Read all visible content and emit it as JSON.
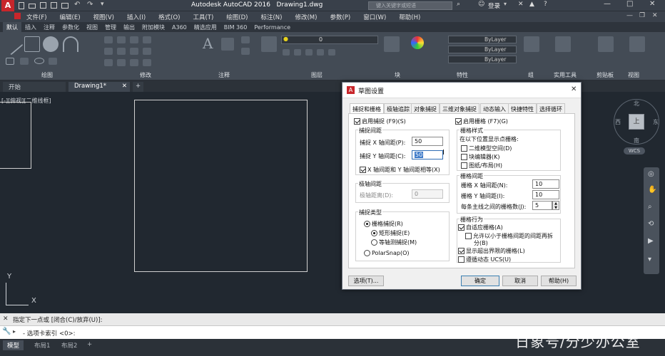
{
  "app": {
    "title": "Autodesk AutoCAD 2016",
    "filename": "Drawing1.dwg",
    "search_placeholder": "键入关键字或短语",
    "login_label": "登录"
  },
  "menu": [
    "文件(F)",
    "编辑(E)",
    "视图(V)",
    "插入(I)",
    "格式(O)",
    "工具(T)",
    "绘图(D)",
    "标注(N)",
    "修改(M)",
    "参数(P)",
    "窗口(W)",
    "帮助(H)"
  ],
  "ribbon_tabs": [
    "默认",
    "插入",
    "注释",
    "参数化",
    "视图",
    "管理",
    "输出",
    "附加模块",
    "A360",
    "精选应用",
    "BIM 360",
    "Performance"
  ],
  "ribbon_groups": [
    "绘图",
    "修改",
    "注释",
    "图层",
    "块",
    "特性",
    "组",
    "实用工具",
    "剪贴板",
    "视图"
  ],
  "ribbon_controls": {
    "layer_value": "0",
    "bylayer1": "ByLayer",
    "bylayer2": "ByLayer",
    "bylayer3": "ByLayer"
  },
  "doc_tabs": {
    "start": "开始",
    "active": "Drawing1*",
    "add": "+"
  },
  "viewport_label": "[-][俯视][二维线框]",
  "viewcube": {
    "n": "北",
    "s": "南",
    "e": "东",
    "w": "西",
    "top": "上",
    "wcs": "WCS"
  },
  "ucs": {
    "x": "X",
    "y": "Y"
  },
  "command": {
    "history": "指定下一点或 [闭合(C)/放弃(U)]:",
    "prompt": "- 选项卡索引 <0>:"
  },
  "layout_tabs": [
    "模型",
    "布局1",
    "布局2",
    "+"
  ],
  "watermark": "日象号/分少办公室",
  "dialog": {
    "title": "草图设置",
    "tabs": [
      "捕捉和栅格",
      "极轴追踪",
      "对象捕捉",
      "三维对象捕捉",
      "动态输入",
      "快捷特性",
      "选择循环"
    ],
    "snap_on": "启用捕捉 (F9)(S)",
    "snap_spacing_title": "捕捉间距",
    "snap_x_label": "捕捉 X 轴间距(P):",
    "snap_x_value": "50",
    "snap_y_label": "捕捉 Y 轴间距(C):",
    "snap_y_value": "50",
    "equal_xy": "X 轴间距和 Y 轴间距相等(X)",
    "polar_spacing_title": "极轴间距",
    "polar_distance_label": "极轴距离(D):",
    "polar_distance_value": "0",
    "snap_type_title": "捕捉类型",
    "grid_snap": "栅格捕捉(R)",
    "rect_snap": "矩形捕捉(E)",
    "iso_snap": "等轴测捕捉(M)",
    "polar_snap": "PolarSnap(O)",
    "grid_on": "启用栅格 (F7)(G)",
    "grid_style_title": "栅格样式",
    "grid_style_sub": "在以下位置显示点栅格:",
    "model_space": "二维模型空间(D)",
    "block_editor": "块编辑器(K)",
    "sheet_layout": "图纸/布局(H)",
    "grid_spacing_title": "栅格间距",
    "grid_x_label": "栅格 X 轴间距(N):",
    "grid_x_value": "10",
    "grid_y_label": "栅格 Y 轴间距(I):",
    "grid_y_value": "10",
    "major_label": "每条主线之间的栅格数(J):",
    "major_value": "5",
    "grid_behavior_title": "栅格行为",
    "adaptive": "自适应栅格(A)",
    "subdivide_line1": "允许以小于栅格间距的间距再拆",
    "subdivide_line2": "分(B)",
    "beyond_limits": "显示超出界限的栅格(L)",
    "follow_ucs": "遵循动态 UCS(U)",
    "options_btn": "选项(T)...",
    "ok_btn": "确定",
    "cancel_btn": "取消",
    "help_btn": "帮助(H)"
  }
}
